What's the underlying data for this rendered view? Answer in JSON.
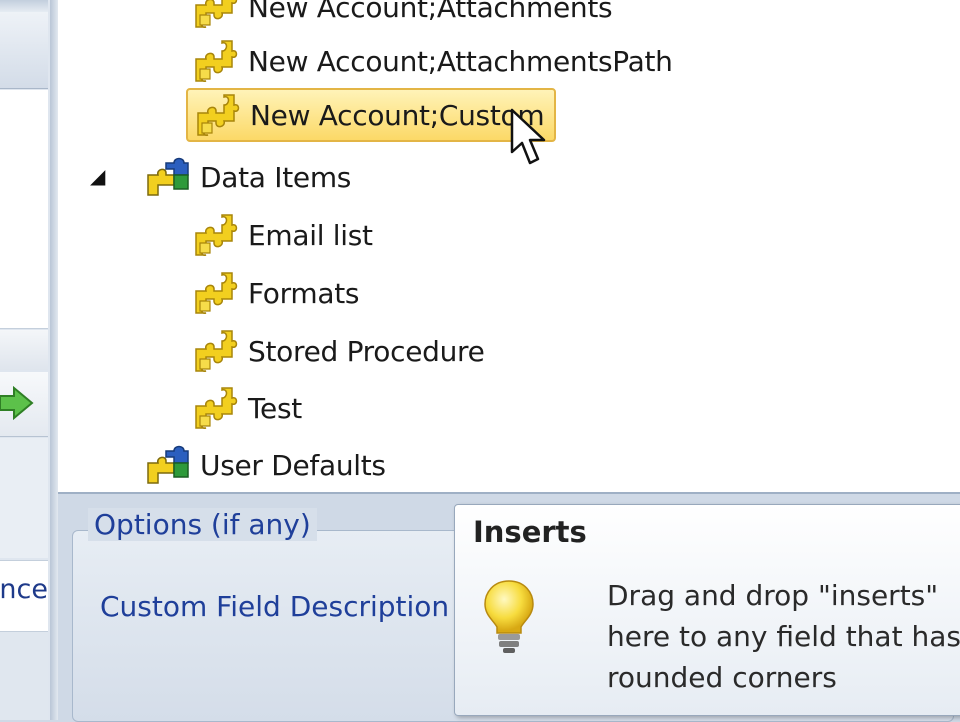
{
  "tree": {
    "items": [
      {
        "label": "New Account;Attachments",
        "icon": "puzzle-yellow-icon"
      },
      {
        "label": "New Account;AttachmentsPath",
        "icon": "puzzle-yellow-icon"
      },
      {
        "label": "New Account;Custom",
        "icon": "puzzle-yellow-icon",
        "selected": true
      },
      {
        "label": "Data Items",
        "icon": "puzzle-multicolor-icon",
        "expanded": true
      },
      {
        "label": "Email list",
        "icon": "puzzle-yellow-icon"
      },
      {
        "label": "Formats",
        "icon": "puzzle-yellow-icon"
      },
      {
        "label": "Stored Procedure",
        "icon": "puzzle-yellow-icon"
      },
      {
        "label": "Test",
        "icon": "puzzle-yellow-icon"
      },
      {
        "label": "User Defaults",
        "icon": "puzzle-multicolor-icon"
      }
    ],
    "expander_glyph": "◢"
  },
  "left_panel": {
    "fragment_text": "ence"
  },
  "options": {
    "title": "Options (if any)",
    "field_label": "Custom Field Description"
  },
  "tooltip": {
    "title": "Inserts",
    "body_lines": [
      "Drag and drop \"inserts\"",
      "here to any field that has",
      "rounded corners"
    ]
  },
  "colors": {
    "selection_fill": "#fcd967",
    "selection_border": "#e3b545",
    "link_blue": "#1f3f9a",
    "puzzle_yellow": "#f2cf1f",
    "puzzle_green": "#2e9a3a",
    "puzzle_blue": "#2b5fbf"
  }
}
